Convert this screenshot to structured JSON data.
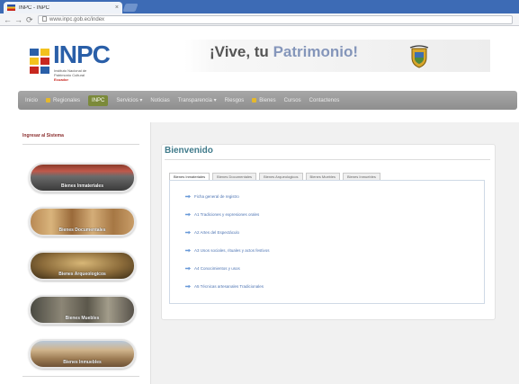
{
  "browser": {
    "tab_title": "INPC - INPC",
    "url": "www.inpc.gob.ec/index",
    "back_icon": "back-arrow-icon",
    "forward_icon": "forward-arrow-icon",
    "reload_icon": "reload-icon"
  },
  "site": {
    "logo_text": "INPC",
    "logo_subtitle_lines": [
      "Instituto Nacional de",
      "Patrimonio Cultural"
    ],
    "logo_country": "Ecuador",
    "slogan_main": "¡Vive, tu",
    "slogan_faded": "Patrimonio!",
    "colors": {
      "blue": "#2a5fa8",
      "yellow": "#f3c21d",
      "red": "#c8271f",
      "menu_active": "#7b8a3a",
      "title_teal": "#3f7a8a"
    }
  },
  "menu": {
    "items": [
      {
        "label": "Inicio",
        "icon": false
      },
      {
        "label": "Regionales",
        "icon": true
      },
      {
        "label": "INPC",
        "icon": false,
        "active": true
      },
      {
        "label": "Servicios",
        "icon": false
      },
      {
        "label": "Noticias",
        "icon": false
      },
      {
        "label": "Transparencia",
        "icon": false
      },
      {
        "label": "Riesgos",
        "icon": false
      },
      {
        "label": "Bienes",
        "icon": true
      },
      {
        "label": "Cursos",
        "icon": false
      },
      {
        "label": "Contactenos",
        "icon": false
      }
    ]
  },
  "sidebar": {
    "title": "Ingresar al Sistema",
    "items": [
      {
        "label": "Bienes Inmateriales"
      },
      {
        "label": "Bienes Documentales"
      },
      {
        "label": "Bienes Arqueologicos"
      },
      {
        "label": "Bienes Muebles"
      },
      {
        "label": "Bienes Inmuebles"
      }
    ]
  },
  "main": {
    "title": "Bienvenido",
    "tabs": [
      "Bienes Inmateriales",
      "Bienes Documentales",
      "Bienes Arqueologicos",
      "Bienes Muebles",
      "Bienes Inmuebles"
    ],
    "links": [
      "Ficha general de registro",
      "A1 Tradiciones y expresiones orales",
      "A2 Artes del Espectáculo",
      "A3 Usos sociales, rituales y actos festivos",
      "A4 Conocimientos y usos",
      "A5 Técnicas artesanales Tradicionales"
    ]
  }
}
